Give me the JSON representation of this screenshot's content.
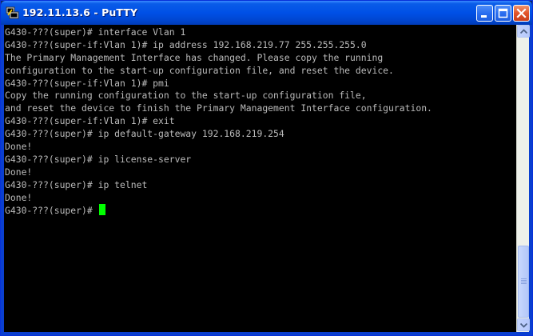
{
  "window": {
    "title": "192.11.13.6 - PuTTY",
    "icon": "putty-icon",
    "controls": {
      "minimize_icon": "minimize-icon",
      "maximize_icon": "maximize-icon",
      "close_icon": "close-icon"
    }
  },
  "terminal": {
    "lines": [
      "G430-???(super)# interface Vlan 1",
      "G430-???(super-if:Vlan 1)# ip address 192.168.219.77 255.255.255.0",
      "The Primary Management Interface has changed. Please copy the running",
      "configuration to the start-up configuration file, and reset the device.",
      "G430-???(super-if:Vlan 1)# pmi",
      "Copy the running configuration to the start-up configuration file,",
      "and reset the device to finish the Primary Management Interface configuration.",
      "G430-???(super-if:Vlan 1)# exit",
      "G430-???(super)# ip default-gateway 192.168.219.254",
      "Done!",
      "G430-???(super)# ip license-server",
      "Done!",
      "G430-???(super)# ip telnet",
      "Done!",
      "G430-???(super)# "
    ],
    "text_color": "#bbbbbb",
    "background_color": "#000000",
    "cursor_color": "#00ff00"
  }
}
